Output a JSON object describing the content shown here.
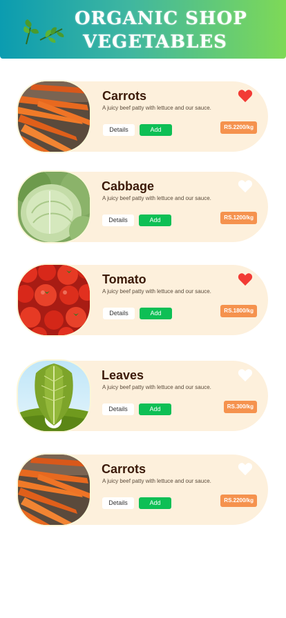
{
  "header": {
    "title_line1": "ORGANIC SHOP",
    "title_line2": "VEGETABLES",
    "gradient_start": "#0b9cb0",
    "gradient_end": "#7ed957"
  },
  "products": [
    {
      "name": "Carrots",
      "description": "A juicy beef patty with lettuce and our sauce.",
      "details_label": "Details",
      "add_label": "Add",
      "price": "RS.2200/kg",
      "favorite": true,
      "image": "carrots"
    },
    {
      "name": "Cabbage",
      "description": "A juicy beef patty with lettuce and our sauce.",
      "details_label": "Details",
      "add_label": "Add",
      "price": "RS.1200/kg",
      "favorite": false,
      "image": "cabbage"
    },
    {
      "name": "Tomato",
      "description": "A juicy beef patty with lettuce and our sauce.",
      "details_label": "Details",
      "add_label": "Add",
      "price": "RS.1800/kg",
      "favorite": true,
      "image": "tomato"
    },
    {
      "name": "Leaves",
      "description": "A juicy beef patty with lettuce and our sauce.",
      "details_label": "Details",
      "add_label": "Add",
      "price": "RS.300/kg",
      "favorite": false,
      "image": "leaves"
    },
    {
      "name": "Carrots",
      "description": "A juicy beef patty with lettuce and our sauce.",
      "details_label": "Details",
      "add_label": "Add",
      "price": "RS.2200/kg",
      "favorite": false,
      "image": "carrots"
    }
  ],
  "colors": {
    "card_bg": "#fdf0dc",
    "add_button": "#0dbf55",
    "price_badge": "#f5924e",
    "heart_active": "#f23b35",
    "heart_inactive": "#ffffff",
    "product_name": "#3b1a08"
  },
  "icons": {
    "favorite": "heart-icon",
    "header_decoration": "leaf-icon"
  }
}
